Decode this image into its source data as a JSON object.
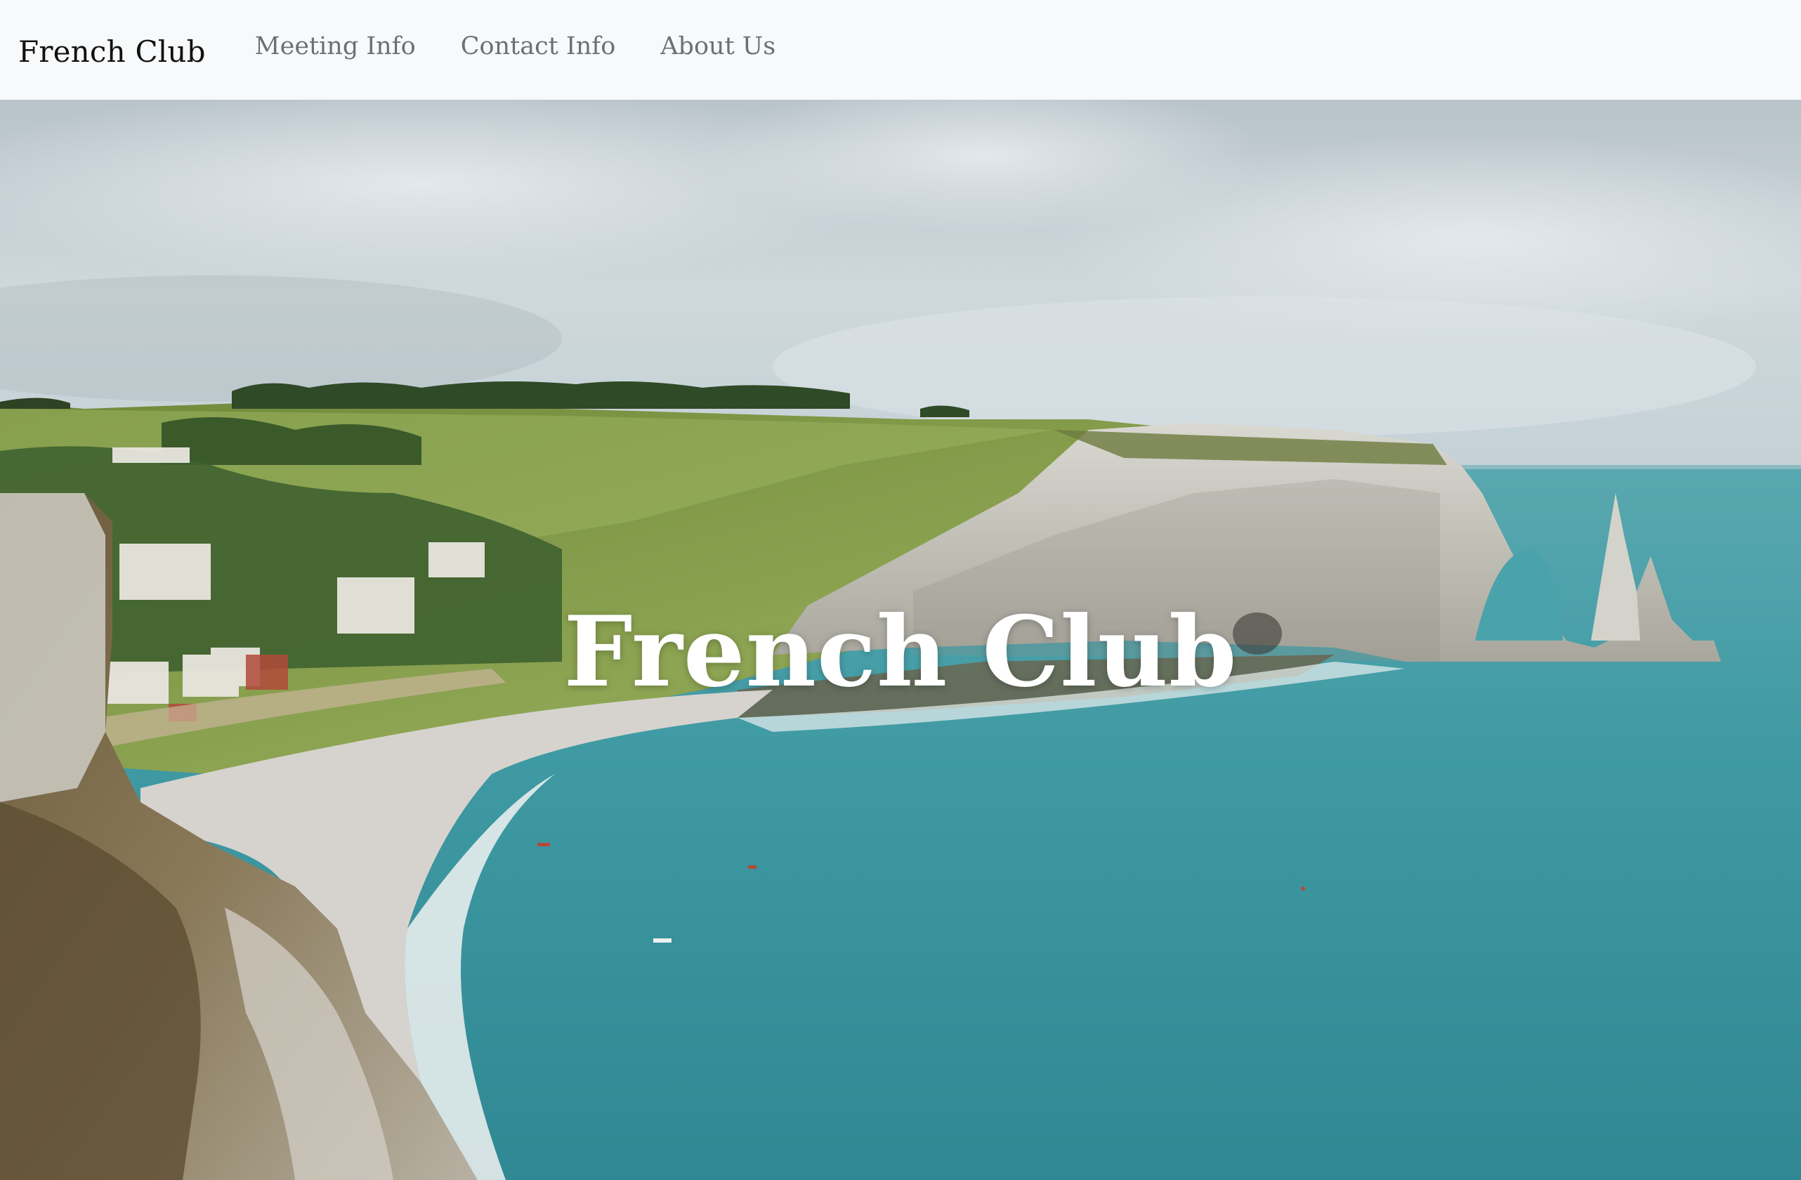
{
  "navbar": {
    "brand": "French Club",
    "links": [
      {
        "label": "Meeting Info"
      },
      {
        "label": "Contact Info"
      },
      {
        "label": "About Us"
      }
    ]
  },
  "hero": {
    "title": "French Club",
    "image_subject": "coastal cliffs with arch over turquoise sea and beach"
  },
  "colors": {
    "navbar_bg": "#f8f9fa",
    "brand_text": "#111111",
    "nav_link_text": "#6c6f73",
    "hero_title": "#ffffff",
    "sea": "#3f9aa3",
    "sky": "#c8d2d8"
  }
}
